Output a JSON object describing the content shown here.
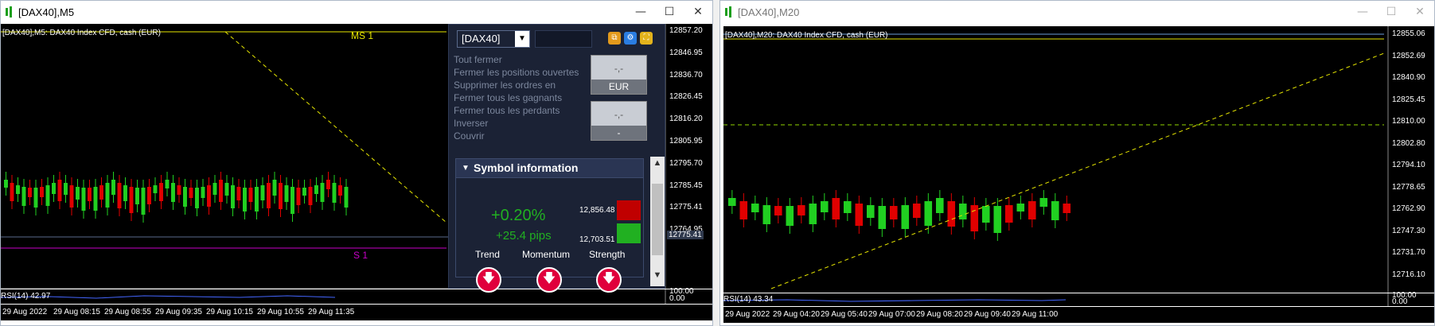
{
  "left_window": {
    "title": "[DAX40],M5",
    "chart_header": "[DAX40],M5:  DAX40 Index CFD, cash (EUR)",
    "price_labels": [
      "12857.20",
      "12846.95",
      "12836.70",
      "12826.45",
      "12816.20",
      "12805.95",
      "12795.70",
      "12785.45",
      "12775.41",
      "12764.95"
    ],
    "rsi_label": "RSI(14) 42.97",
    "rsi_scale": [
      "100.00",
      "0.00"
    ],
    "time_labels": [
      "29 Aug 2022",
      "29 Aug 08:15",
      "29 Aug 08:55",
      "29 Aug 09:35",
      "29 Aug 10:15",
      "29 Aug 10:55",
      "29 Aug 11:35"
    ],
    "ms_label": "MS 1",
    "s_label": "S 1",
    "current_price": "12775.41"
  },
  "panel": {
    "symbol": "[DAX40]",
    "menu": [
      "Tout fermer",
      "Fermer les positions ouvertes",
      "Supprimer les ordres en",
      "Fermer tous les gagnants",
      "Fermer tous les perdants",
      "Inverser",
      "Couvrir"
    ],
    "btn1_top": "-,-",
    "btn1_bottom": "EUR",
    "btn2_top": "-,-",
    "btn2_bottom": "-",
    "section_title": "Symbol information",
    "change_pct": "+0.20%",
    "change_pips": "+25.4 pips",
    "high": "12,856.48",
    "low": "12,703.51",
    "trend_label": "Trend",
    "momentum_label": "Momentum",
    "strength_label": "Strength",
    "colors": {
      "up": "#21b021",
      "down": "#c00000",
      "arrow": "#e0003c"
    }
  },
  "right_window": {
    "title": "[DAX40],M20",
    "chart_header": "[DAX40],M20:  DAX40 Index CFD, cash (EUR)",
    "price_labels": [
      "12855.06",
      "12852.69",
      "12840.90",
      "12825.45",
      "12810.00",
      "12802.80",
      "12794.10",
      "12778.65",
      "12762.90",
      "12747.30",
      "12731.70",
      "12716.10"
    ],
    "rsi_label": "RSI(14) 43.34",
    "rsi_scale": [
      "100.00",
      "0.00"
    ],
    "time_labels": [
      "29 Aug 2022",
      "29 Aug 04:20",
      "29 Aug 05:40",
      "29 Aug 07:00",
      "29 Aug 08:20",
      "29 Aug 09:40",
      "29 Aug 11:00"
    ]
  }
}
